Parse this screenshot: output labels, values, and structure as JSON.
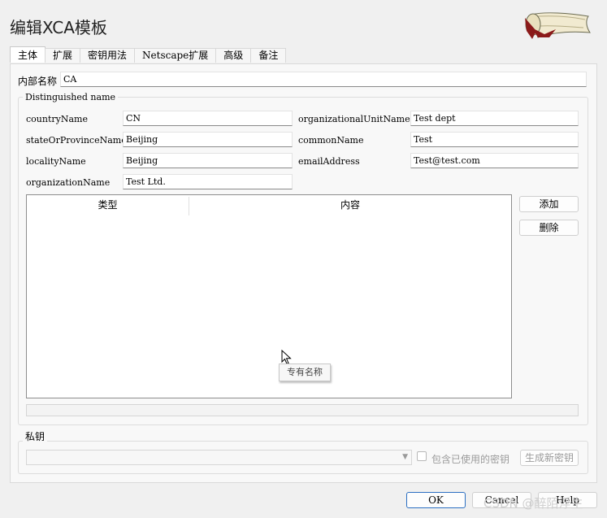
{
  "window": {
    "title": "编辑XCA模板"
  },
  "tabs": [
    {
      "label": "主体",
      "active": true
    },
    {
      "label": "扩展"
    },
    {
      "label": "密钥用法"
    },
    {
      "label": "Netscape扩展"
    },
    {
      "label": "高级"
    },
    {
      "label": "备注"
    }
  ],
  "internal_name": {
    "label": "内部名称",
    "value": "CA"
  },
  "dn": {
    "title": "Distinguished name",
    "country": {
      "label": "countryName",
      "value": "CN"
    },
    "state": {
      "label": "stateOrProvinceName",
      "value": "Beijing"
    },
    "locality": {
      "label": "localityName",
      "value": "Beijing"
    },
    "organization": {
      "label": "organizationName",
      "value": "Test Ltd."
    },
    "org_unit": {
      "label": "organizationalUnitName",
      "value": " Test dept"
    },
    "common_name": {
      "label": "commonName",
      "value": "Test"
    },
    "email": {
      "label": "emailAddress",
      "value": "Test@test.com"
    },
    "table": {
      "columns": [
        "类型",
        "内容"
      ],
      "rows": []
    },
    "add_label": "添加",
    "delete_label": "删除",
    "tooltip": "专有名称"
  },
  "private_key": {
    "title": "私钥",
    "combo_value": "",
    "include_used_label": "包含已使用的密钥",
    "include_used_checked": false,
    "generate_label": "生成新密钥"
  },
  "footer": {
    "ok_label": "OK",
    "cancel_label": "Cancel",
    "help_label": "Help"
  },
  "watermark": "CSDN @醉陌浮生",
  "colors": {
    "primary_border": "#2b6fc2",
    "window_bg": "#f0f0f0"
  }
}
